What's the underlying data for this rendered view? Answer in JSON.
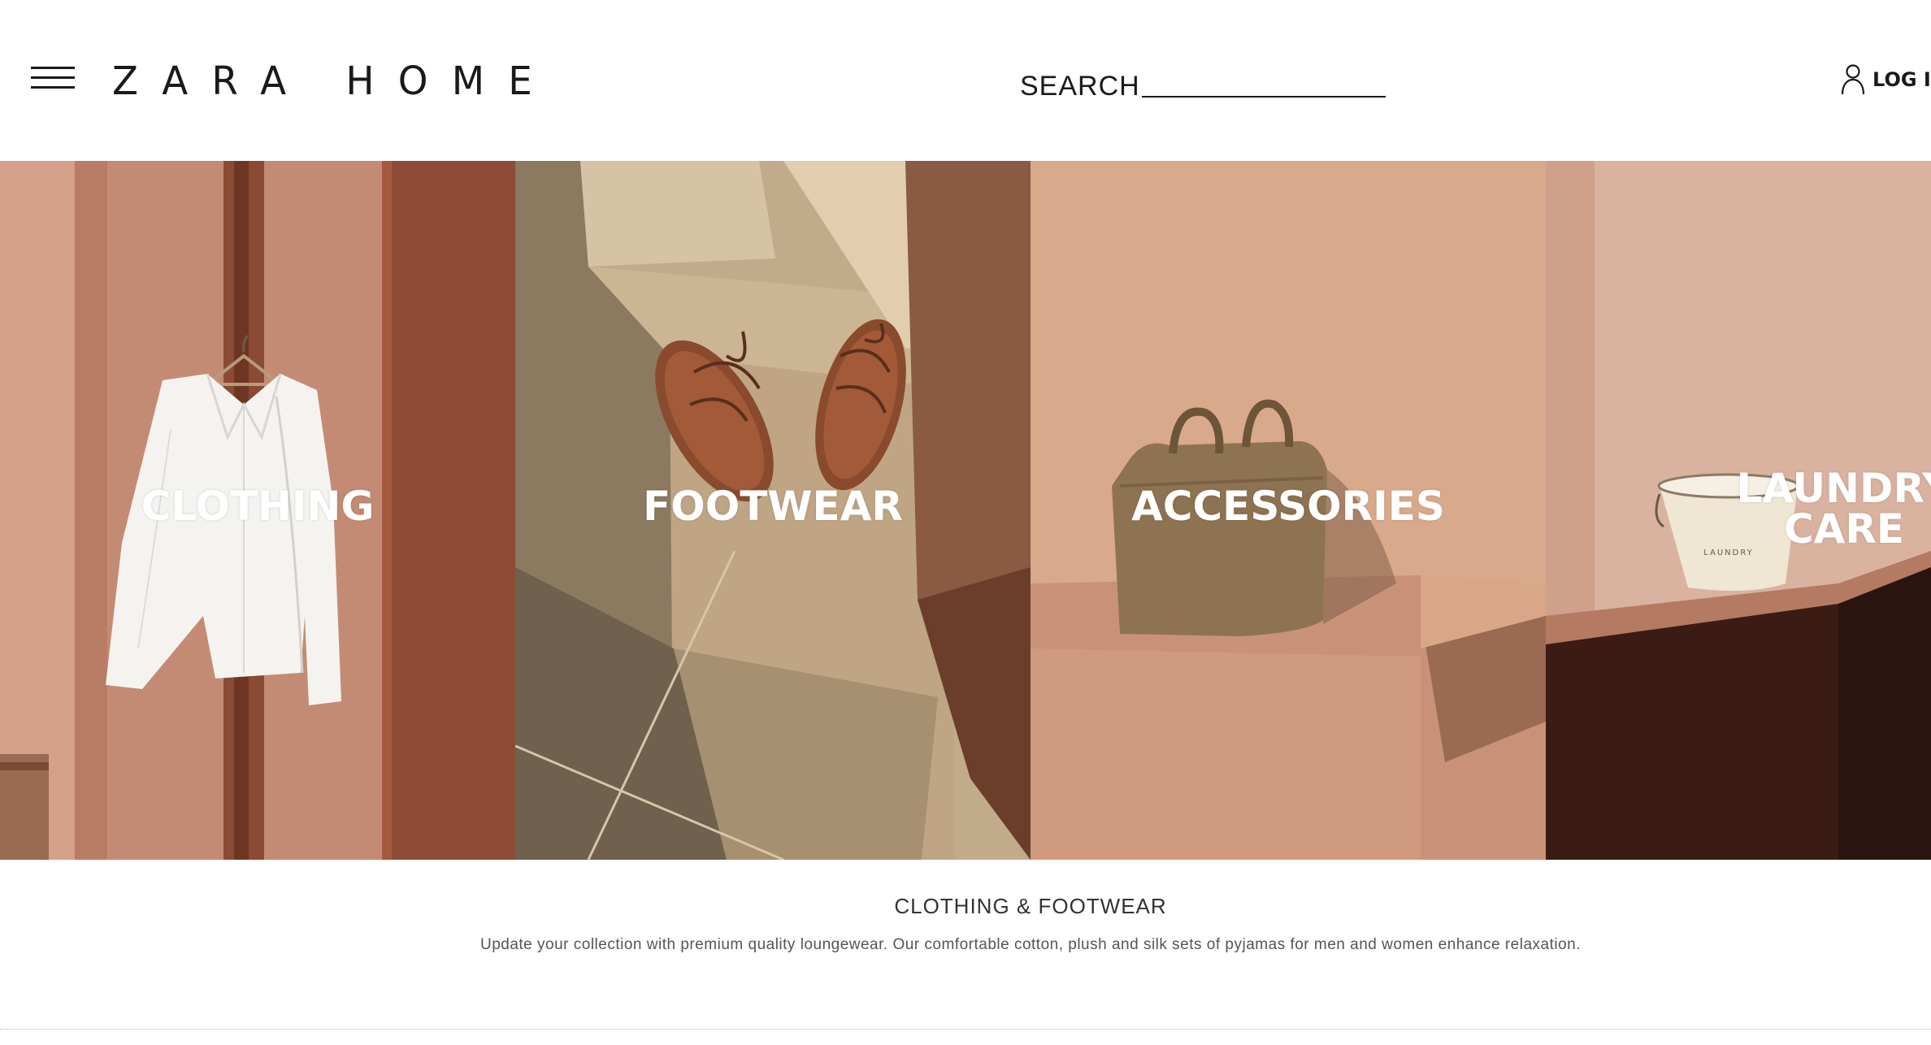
{
  "header": {
    "logo_text": "ZARA HOME",
    "search_label": "SEARCH",
    "login_label": "LOG IN"
  },
  "categories": [
    {
      "label": "CLOTHING"
    },
    {
      "label": "FOOTWEAR"
    },
    {
      "label": "ACCESSORIES"
    },
    {
      "label": "LAUNDRY CARE",
      "lines": [
        "LAUNDRY",
        "CARE"
      ]
    }
  ],
  "section": {
    "title": "CLOTHING & FOOTWEAR",
    "description": "Update your collection with premium quality loungewear. Our comfortable cotton, plush and silk sets of pyjamas for men and women enhance relaxation."
  },
  "icons": {
    "menu": "hamburger-menu-icon",
    "user": "user-icon"
  },
  "colors": {
    "text": "#1a1a1a",
    "terracotta": "#c98b72",
    "stone": "#b8a07e"
  }
}
